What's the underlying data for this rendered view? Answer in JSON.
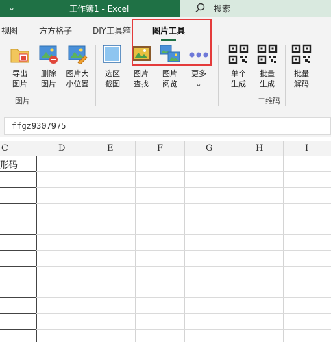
{
  "titlebar": {
    "title": "工作簿1 - Excel",
    "search_label": "搜索"
  },
  "tabs": [
    {
      "label": "视图"
    },
    {
      "label": "方方格子"
    },
    {
      "label": "DIY工具箱"
    },
    {
      "label": "图片工具",
      "active": true
    }
  ],
  "ribbon": {
    "buttons": [
      {
        "label": "导出\n图片",
        "icon": "folder-image-icon"
      },
      {
        "label": "删除\n图片",
        "icon": "image-delete-icon"
      },
      {
        "label": "图片大\n小位置",
        "icon": "image-resize-icon"
      },
      {
        "label": "选区\n截图",
        "icon": "screenshot-icon"
      },
      {
        "label": "图片\n查找",
        "icon": "image-find-icon"
      },
      {
        "label": "图片\n阅览",
        "icon": "image-browse-icon"
      },
      {
        "label": "更多\n⌄",
        "icon": "more-icon"
      },
      {
        "label": "单个\n生成",
        "icon": "qr-code-icon"
      },
      {
        "label": "批量\n生成",
        "icon": "qr-batch-icon"
      },
      {
        "label": "批量\n解码",
        "icon": "qr-decode-icon"
      }
    ],
    "groups": [
      {
        "label": "图片"
      },
      {
        "label": "二维码"
      }
    ]
  },
  "formula_bar": {
    "value": "ffgz9307975"
  },
  "columns": [
    "C",
    "D",
    "E",
    "F",
    "G",
    "H",
    "I"
  ],
  "cells": {
    "c1": "形码"
  },
  "colors": {
    "accent": "#1f7145",
    "highlight": "#e43b3b"
  }
}
